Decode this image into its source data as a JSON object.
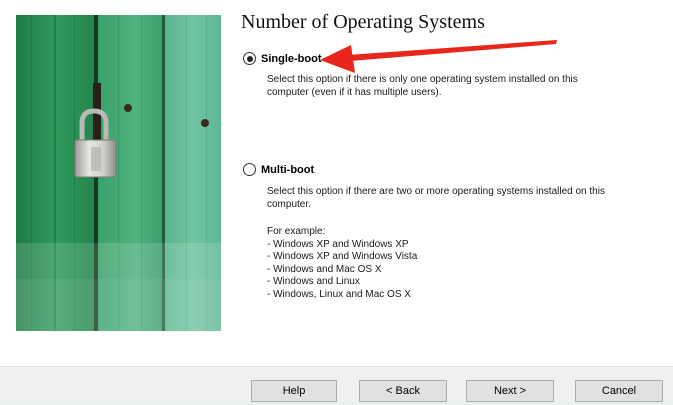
{
  "page": {
    "title": "Number of Operating Systems"
  },
  "options": {
    "single_boot": {
      "label": "Single-boot",
      "selected": true,
      "description_line1": "Select this option if there is only one operating system installed on this",
      "description_line2": "computer (even if it has multiple users)."
    },
    "multi_boot": {
      "label": "Multi-boot",
      "selected": false,
      "description_line1": "Select this option if there are two or more operating systems installed on this",
      "description_line2": "computer.",
      "example_heading": "For example:",
      "examples": [
        "- Windows XP and Windows XP",
        "- Windows XP and Windows Vista",
        "- Windows and Mac OS X",
        "- Windows and Linux",
        "- Windows, Linux and Mac OS X"
      ]
    }
  },
  "buttons": {
    "help": "Help",
    "back": "< Back",
    "next": "Next >",
    "cancel": "Cancel"
  },
  "colors": {
    "annotation_arrow": "#e8261c",
    "door_green": "#2f9a5c",
    "padlock_silver": "#c8c8c4"
  }
}
